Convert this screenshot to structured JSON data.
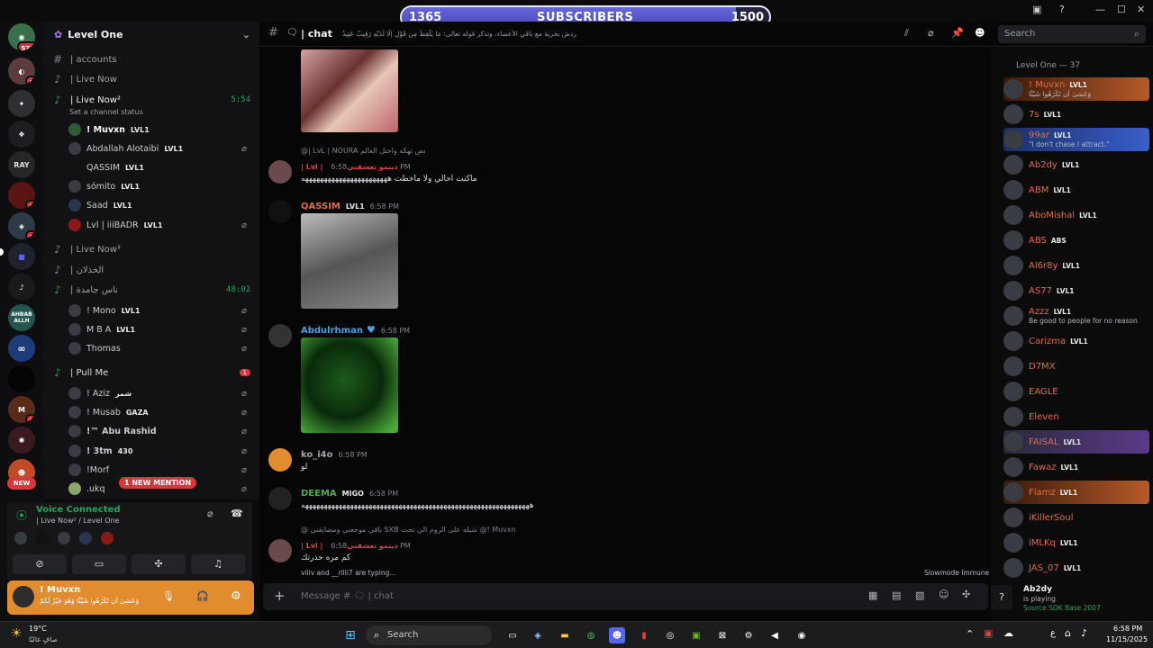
{
  "overlay": {
    "current": "1365",
    "label": "SUBSCRIBERS",
    "goal": "1500",
    "progress": 0.91
  },
  "server": {
    "name": "Level One"
  },
  "rail": {
    "badges": [
      "571",
      "2",
      "2",
      "3",
      "2",
      "4"
    ],
    "items": [
      "RAY",
      "AHBAB ALLH",
      "NEW"
    ]
  },
  "channels": [
    {
      "icon": "#",
      "label": "| accounts"
    },
    {
      "icon": "🔊",
      "label": "| Live Now"
    },
    {
      "icon": "🔊",
      "label": "| Live Now²",
      "count": "5:54",
      "status": "Set a channel status"
    }
  ],
  "live_now_users": [
    {
      "name": "! Muvxn",
      "tag": "LVL1"
    },
    {
      "name": "Abdallah Alotaibi",
      "tag": "LVL1"
    },
    {
      "name": "QASSIM",
      "tag": "LVL1"
    },
    {
      "name": "sómito",
      "tag": "LVL1"
    },
    {
      "name": "Saad",
      "tag": "LVL1"
    },
    {
      "name": "Lvl | iiiBADR",
      "tag": "LVL1"
    }
  ],
  "channels2": [
    {
      "label": "| Live Now³"
    },
    {
      "label": "| الخذلان"
    },
    {
      "label": "| ناس جامدة",
      "count": "48:02"
    }
  ],
  "group2_users": [
    {
      "name": "! Mono",
      "tag": "LVL1"
    },
    {
      "name": "M B A",
      "tag": "LVL1"
    },
    {
      "name": "Thomas",
      "tag": ""
    }
  ],
  "pull_me": {
    "label": "| Pull Me",
    "badge": "1"
  },
  "pull_users": [
    {
      "name": "! Aziz",
      "tag": "شمر"
    },
    {
      "name": "! Musab",
      "tag": "GAZA"
    },
    {
      "name": "!™ Abu Rashid",
      "tag": ""
    },
    {
      "name": "! 3tm",
      "tag": "430"
    },
    {
      "name": "!Morf",
      "tag": ""
    },
    {
      "name": ".ukq",
      "tag": ""
    }
  ],
  "new_mention": "1 NEW MENTION",
  "voice": {
    "title": "Voice Connected",
    "sub": "| Live Now² / Level One"
  },
  "userbar": {
    "name": "! Muvxn",
    "sub": "وَعَسَىٰ أَن تَكْرَهُوا شَيْئًا وَهُوَ خَيْرٌ لَّكُمْ"
  },
  "chat": {
    "channel": "| chat",
    "topic": "دردش بحرية مع باقي الأعضاء، وتذكر قوله تعالى: مَا يَلْفِظُ مِن قَوْلٍ إِلَّا لَدَيْهِ رَقِيبٌ عَتِيدٌ",
    "search_placeholder": "Search",
    "messages": [
      {
        "reply": "@| LvL | NOURA  نص تهكه واحتل العالم",
        "user": "| Lvl | دينمو تعشقني",
        "color": "#d64545",
        "time": "6:58 PM",
        "text": "ماكنت احالي ولا ماخطت هههههههههههههههههههههههه"
      },
      {
        "user": "QASSIM",
        "tag": "LVL1",
        "color": "#e06c4a",
        "time": "6:58 PM",
        "text": ""
      },
      {
        "user": "Abdulrhman",
        "color": "#4aa3df",
        "time": "6:58 PM",
        "text": ""
      },
      {
        "user": "ko_i4o",
        "color": "#9ea2a8",
        "time": "6:58 PM",
        "text": "لو"
      },
      {
        "user": "DEEMA",
        "tag": "MIGO",
        "color": "#5aa45a",
        "time": "6:58 PM",
        "text": "هههههههههههههههههههههههههههههههههههههههههههههههههههههههههههههه"
      },
      {
        "reply": "@ باقي موجعني ومضايقني  SXB  شيله على الروم الي تحت  @! Muvxn",
        "user": "| Lvl | دينمو تعشقني",
        "color": "#d64545",
        "time": "6:58 PM",
        "text": "كم مره حذرتك"
      }
    ],
    "typing": "viliv and __rilli7 are typing...",
    "slowmode": "Slowmode Immune",
    "input_placeholder": "Message # 🗨 | chat"
  },
  "members": {
    "header": "Level One — 37",
    "list": [
      {
        "name": "! Muvxn",
        "tag": "LVL1",
        "color": "#e06c4a",
        "sub": "وَعَسَىٰ أَن تَكْرَهُوا شَيْئًا"
      },
      {
        "name": "7s",
        "tag": "LVL1",
        "color": "#e06c4a"
      },
      {
        "name": "99ar",
        "tag": "LVL1",
        "color": "#e06c4a",
        "sub": "\"I don't chase I attract.\""
      },
      {
        "name": "Ab2dy",
        "tag": "LVL1",
        "color": "#e06c4a"
      },
      {
        "name": "ABM",
        "tag": "LVL1",
        "color": "#e06c4a"
      },
      {
        "name": "AboMishal",
        "tag": "LVL1",
        "color": "#e06c4a"
      },
      {
        "name": "ABS",
        "tag": "ABS",
        "color": "#e06c4a"
      },
      {
        "name": "Al6r8y",
        "tag": "LVL1",
        "color": "#e06c4a"
      },
      {
        "name": "AS77",
        "tag": "LVL1",
        "color": "#e06c4a"
      },
      {
        "name": "Azzz",
        "tag": "LVL1",
        "color": "#e06c4a",
        "sub": "Be good to people for no reason"
      },
      {
        "name": "Carizma",
        "tag": "LVL1",
        "color": "#e06c4a"
      },
      {
        "name": "D7MX",
        "tag": "",
        "color": "#e06c4a"
      },
      {
        "name": "EAGLE",
        "tag": "",
        "color": "#e06c4a"
      },
      {
        "name": "Eleven",
        "tag": "",
        "color": "#e06c4a"
      },
      {
        "name": "FAISAL",
        "tag": "LVL1",
        "color": "#e06c4a"
      },
      {
        "name": "Fawaz",
        "tag": "LVL1",
        "color": "#e06c4a"
      },
      {
        "name": "Flamz",
        "tag": "LVL1",
        "color": "#e06c4a"
      },
      {
        "name": "iKillerSoul",
        "tag": "",
        "color": "#e06c4a"
      },
      {
        "name": "iMLKq",
        "tag": "LVL1",
        "color": "#e06c4a"
      },
      {
        "name": "JAS_07",
        "tag": "LVL1",
        "color": "#e06c4a"
      }
    ]
  },
  "activity": {
    "name": "Ab2dy",
    "status": "is playing",
    "game": "Source SDK Base 2007"
  },
  "taskbar": {
    "weather_temp": "19°C",
    "weather_desc": "صافٍ غالبًا",
    "search": "Search",
    "time": "6:58 PM",
    "date": "11/15/2025",
    "lang": "ع"
  },
  "colors": {
    "accent": "#5865f2",
    "danger": "#da373c",
    "online": "#23a55a",
    "userbar": "#e18c2f"
  }
}
